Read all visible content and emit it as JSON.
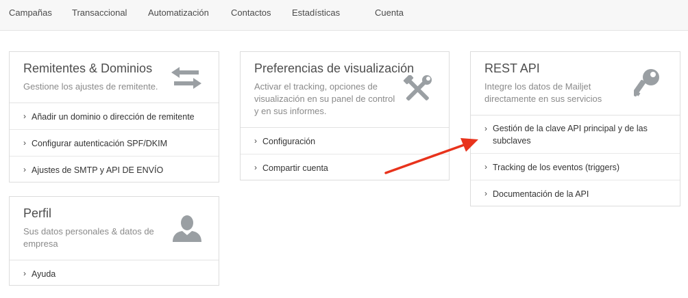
{
  "nav": {
    "items": [
      "Campañas",
      "Transaccional",
      "Automatización",
      "Contactos",
      "Estadísticas",
      "Cuenta"
    ]
  },
  "cards": {
    "senders": {
      "title": "Remitentes & Dominios",
      "subtitle": "Gestione los ajustes de remitente.",
      "icon": "swap-arrows-icon",
      "links": [
        "Añadir un dominio o dirección de remitente",
        "Configurar autenticación SPF/DKIM",
        "Ajustes de SMTP y API DE ENVÍO"
      ]
    },
    "preferences": {
      "title": "Preferencias de visualización",
      "subtitle": "Activar el tracking, opciones de visualización en su panel de control y en sus informes.",
      "icon": "tools-icon",
      "links": [
        "Configuración",
        "Compartir cuenta"
      ]
    },
    "restapi": {
      "title": "REST API",
      "subtitle": "Integre los datos de Mailjet directamente en sus servicios",
      "icon": "key-icon",
      "links": [
        "Gestión de la clave API principal y de las subclaves",
        "Tracking de los eventos (triggers)",
        "Documentación de la API"
      ]
    },
    "profile": {
      "title": "Perfil",
      "subtitle": "Sus datos personales & datos de empresa",
      "icon": "user-icon",
      "links": [
        "Ayuda"
      ]
    }
  },
  "colors": {
    "annotation_arrow": "#e8331c",
    "icon_gray": "#9a9fa3"
  },
  "icons": {
    "chevron": "›"
  }
}
